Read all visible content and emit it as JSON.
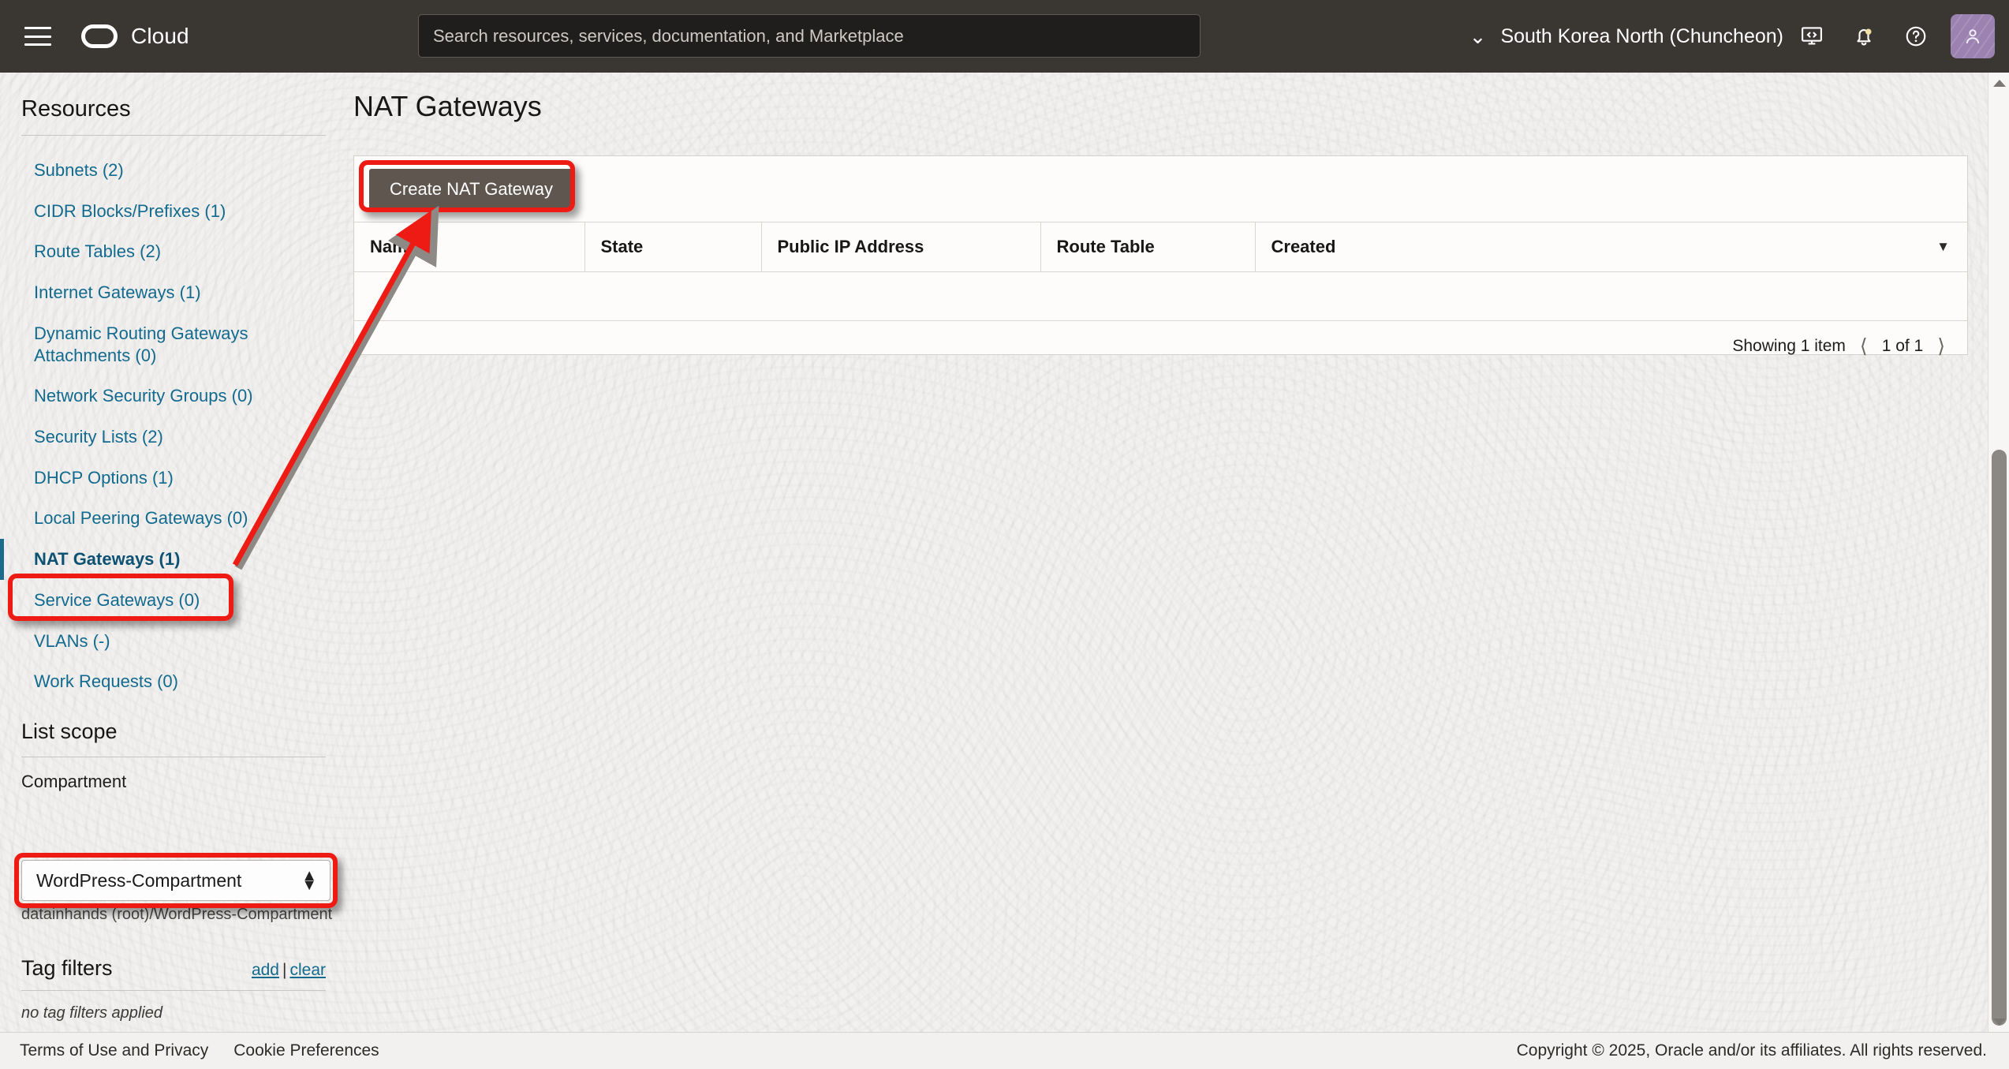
{
  "topbar": {
    "menu_icon": "hamburger-menu-icon",
    "brand_icon": "oracle-logo-icon",
    "brand": "Cloud",
    "search_placeholder": "Search resources, services, documentation, and Marketplace",
    "region": "South Korea North (Chuncheon)",
    "region_chevron": "chevron-down-icon",
    "icons": {
      "cloud_shell": "cloud-shell-icon",
      "notifications": "bell-icon",
      "help": "help-circle-icon",
      "profile": "user-avatar-icon"
    }
  },
  "sidebar": {
    "resources_title": "Resources",
    "items": [
      {
        "label": "Subnets (2)",
        "active": false
      },
      {
        "label": "CIDR Blocks/Prefixes (1)",
        "active": false
      },
      {
        "label": "Route Tables (2)",
        "active": false
      },
      {
        "label": "Internet Gateways (1)",
        "active": false
      },
      {
        "label": "Dynamic Routing Gateways Attachments (0)",
        "active": false
      },
      {
        "label": "Network Security Groups (0)",
        "active": false
      },
      {
        "label": "Security Lists (2)",
        "active": false
      },
      {
        "label": "DHCP Options (1)",
        "active": false
      },
      {
        "label": "Local Peering Gateways (0)",
        "active": false
      },
      {
        "label": "NAT Gateways (1)",
        "active": true
      },
      {
        "label": "Service Gateways (0)",
        "active": false
      },
      {
        "label": "VLANs (-)",
        "active": false
      },
      {
        "label": "Work Requests (0)",
        "active": false
      }
    ],
    "list_scope_title": "List scope",
    "compartment_label": "Compartment",
    "compartment_value": "WordPress-Compartment",
    "compartment_path": "datainhands (root)/WordPress-Compartment",
    "tag_filters_title": "Tag filters",
    "tag_add": "add",
    "tag_sep": "|",
    "tag_clear": "clear",
    "no_tag_filters": "no tag filters applied"
  },
  "main": {
    "page_title": "NAT Gateways",
    "create_button": "Create NAT Gateway",
    "table": {
      "columns": [
        "Name",
        "State",
        "Public IP Address",
        "Route Table",
        "Created"
      ],
      "rows": [],
      "sort_caret": "caret-down-icon"
    },
    "pagination": {
      "showing": "Showing 1 item",
      "page": "1 of 1",
      "prev_icon": "chevron-left-icon",
      "next_icon": "chevron-right-icon"
    }
  },
  "footer": {
    "terms": "Terms of Use and Privacy",
    "cookies": "Cookie Preferences",
    "copyright": "Copyright © 2025, Oracle and/or its affiliates. All rights reserved."
  },
  "annotations": {
    "highlight_color": "#ee1b15",
    "boxes": [
      "create-nat-gateway-button",
      "nat-gateways-sidebar-item",
      "compartment-select"
    ],
    "arrow": "arrow-from-nat-gateways-to-create-button"
  },
  "scrollbar": {
    "up_icon": "triangle-up-icon",
    "down_icon": "triangle-down-icon"
  }
}
